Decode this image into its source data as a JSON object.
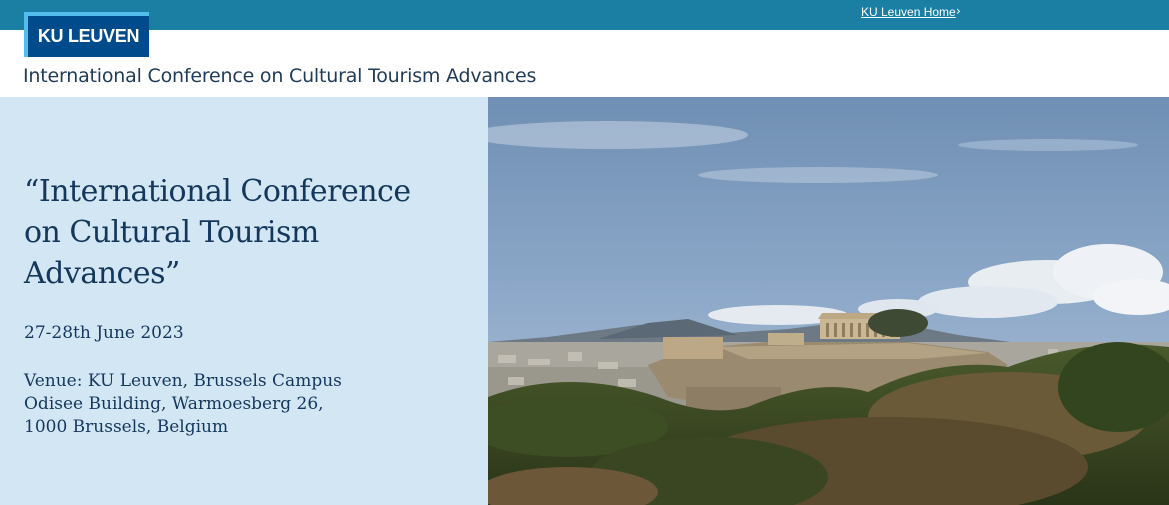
{
  "topbar": {
    "home_link": "KU Leuven Home",
    "chevron": "›",
    "color": "#1a7fa3"
  },
  "logo": {
    "text": "KU LEUVEN",
    "bg_color": "#004b8c",
    "accent_color": "#52bdec"
  },
  "site": {
    "title": "International Conference on Cultural Tourism Advances"
  },
  "hero": {
    "title": "“International Conference  on Cultural Tourism Advances”",
    "date": "27-28th June 2023",
    "venue": [
      "Venue: KU Leuven, Brussels Campus",
      "Odisee Building, Warmoesberg 26,",
      "1000 Brussels, Belgium"
    ],
    "panel_color": "#d3e6f3",
    "text_color": "#14375c",
    "image_icon": "photo-acropolis"
  }
}
